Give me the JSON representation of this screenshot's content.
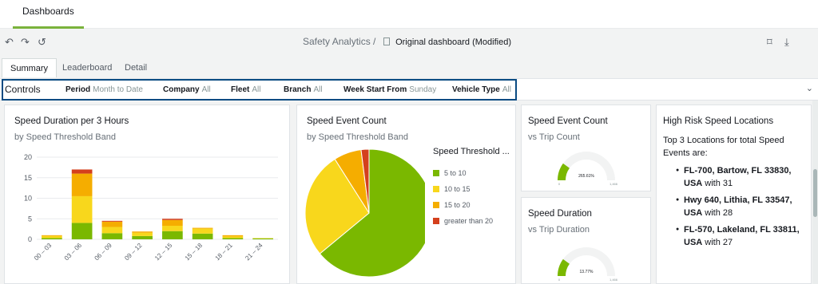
{
  "top_tab": {
    "label": "Dashboards"
  },
  "toolbar": {
    "breadcrumb": "Safety Analytics /",
    "dashboard_name": "Original dashboard (Modified)"
  },
  "subtabs": [
    "Summary",
    "Leaderboard",
    "Detail"
  ],
  "controls": {
    "title": "Controls",
    "items": [
      {
        "label": "Period",
        "value": "Month to Date"
      },
      {
        "label": "Company",
        "value": "All"
      },
      {
        "label": "Fleet",
        "value": "All"
      },
      {
        "label": "Branch",
        "value": "All"
      },
      {
        "label": "Week Start From",
        "value": "Sunday"
      },
      {
        "label": "Vehicle Type",
        "value": "All"
      }
    ]
  },
  "cards": {
    "duration_chart": {
      "title": "Speed Duration per 3 Hours",
      "subtitle": "by Speed Threshold Band"
    },
    "event_count": {
      "title": "Speed Event Count",
      "subtitle": "by Speed Threshold Band",
      "legend_title": "Speed Threshold ..."
    },
    "event_vs_trip": {
      "title": "Speed Event Count",
      "subtitle": "vs Trip Count",
      "gauge_value": "265.61%",
      "gauge_min": "0",
      "gauge_max": "1,466"
    },
    "duration_vs_trip": {
      "title": "Speed Duration",
      "subtitle": "vs Trip Duration",
      "gauge_value": "13.77%",
      "gauge_min": "0",
      "gauge_max": "1,466"
    },
    "high_risk": {
      "title": "High Risk Speed Locations",
      "intro": "Top 3 Locations for total Speed Events are:",
      "locations": [
        {
          "name": "FL-700, Bartow, FL 33830, USA",
          "suffix": " with 31"
        },
        {
          "name": "Hwy 640, Lithia, FL 33547, USA",
          "suffix": " with 28"
        },
        {
          "name": "FL-570, Lakeland, FL 33811, USA",
          "suffix": " with 27"
        }
      ]
    }
  },
  "colors": {
    "band_5_10": "#7ab800",
    "band_10_15": "#f8d71c",
    "band_15_20": "#f5ad00",
    "band_gt_20": "#d4401d"
  },
  "chart_data": [
    {
      "type": "bar",
      "stacked": true,
      "categories": [
        "00 – 03",
        "03 – 06",
        "06 – 09",
        "09 – 12",
        "12 – 15",
        "15 – 18",
        "18 – 21",
        "21 – 24"
      ],
      "series": [
        {
          "name": "5 to 10",
          "values": [
            0.3,
            4.0,
            1.5,
            0.8,
            2.0,
            1.4,
            0.3,
            0.2
          ]
        },
        {
          "name": "10 to 15",
          "values": [
            0.5,
            6.5,
            1.5,
            0.8,
            1.3,
            1.2,
            0.4,
            0.1
          ]
        },
        {
          "name": "15 to 20",
          "values": [
            0.2,
            5.5,
            1.3,
            0.3,
            1.4,
            0.2,
            0.3,
            0.0
          ]
        },
        {
          "name": "greater than 20",
          "values": [
            0.0,
            1.0,
            0.2,
            0.0,
            0.3,
            0.0,
            0.0,
            0.0
          ]
        }
      ],
      "yticks": [
        0,
        5,
        10,
        15,
        20
      ],
      "ylim": [
        0,
        20
      ],
      "grid": true
    },
    {
      "type": "pie",
      "labels": [
        "5 to 10",
        "10 to 15",
        "15 to 20",
        "greater than 20"
      ],
      "values": [
        64,
        27,
        7,
        2
      ]
    },
    {
      "type": "gauge",
      "value": 265.61,
      "min": 0,
      "max": 1466
    },
    {
      "type": "gauge",
      "value": 13.77,
      "min": 0,
      "max": 1466
    }
  ]
}
